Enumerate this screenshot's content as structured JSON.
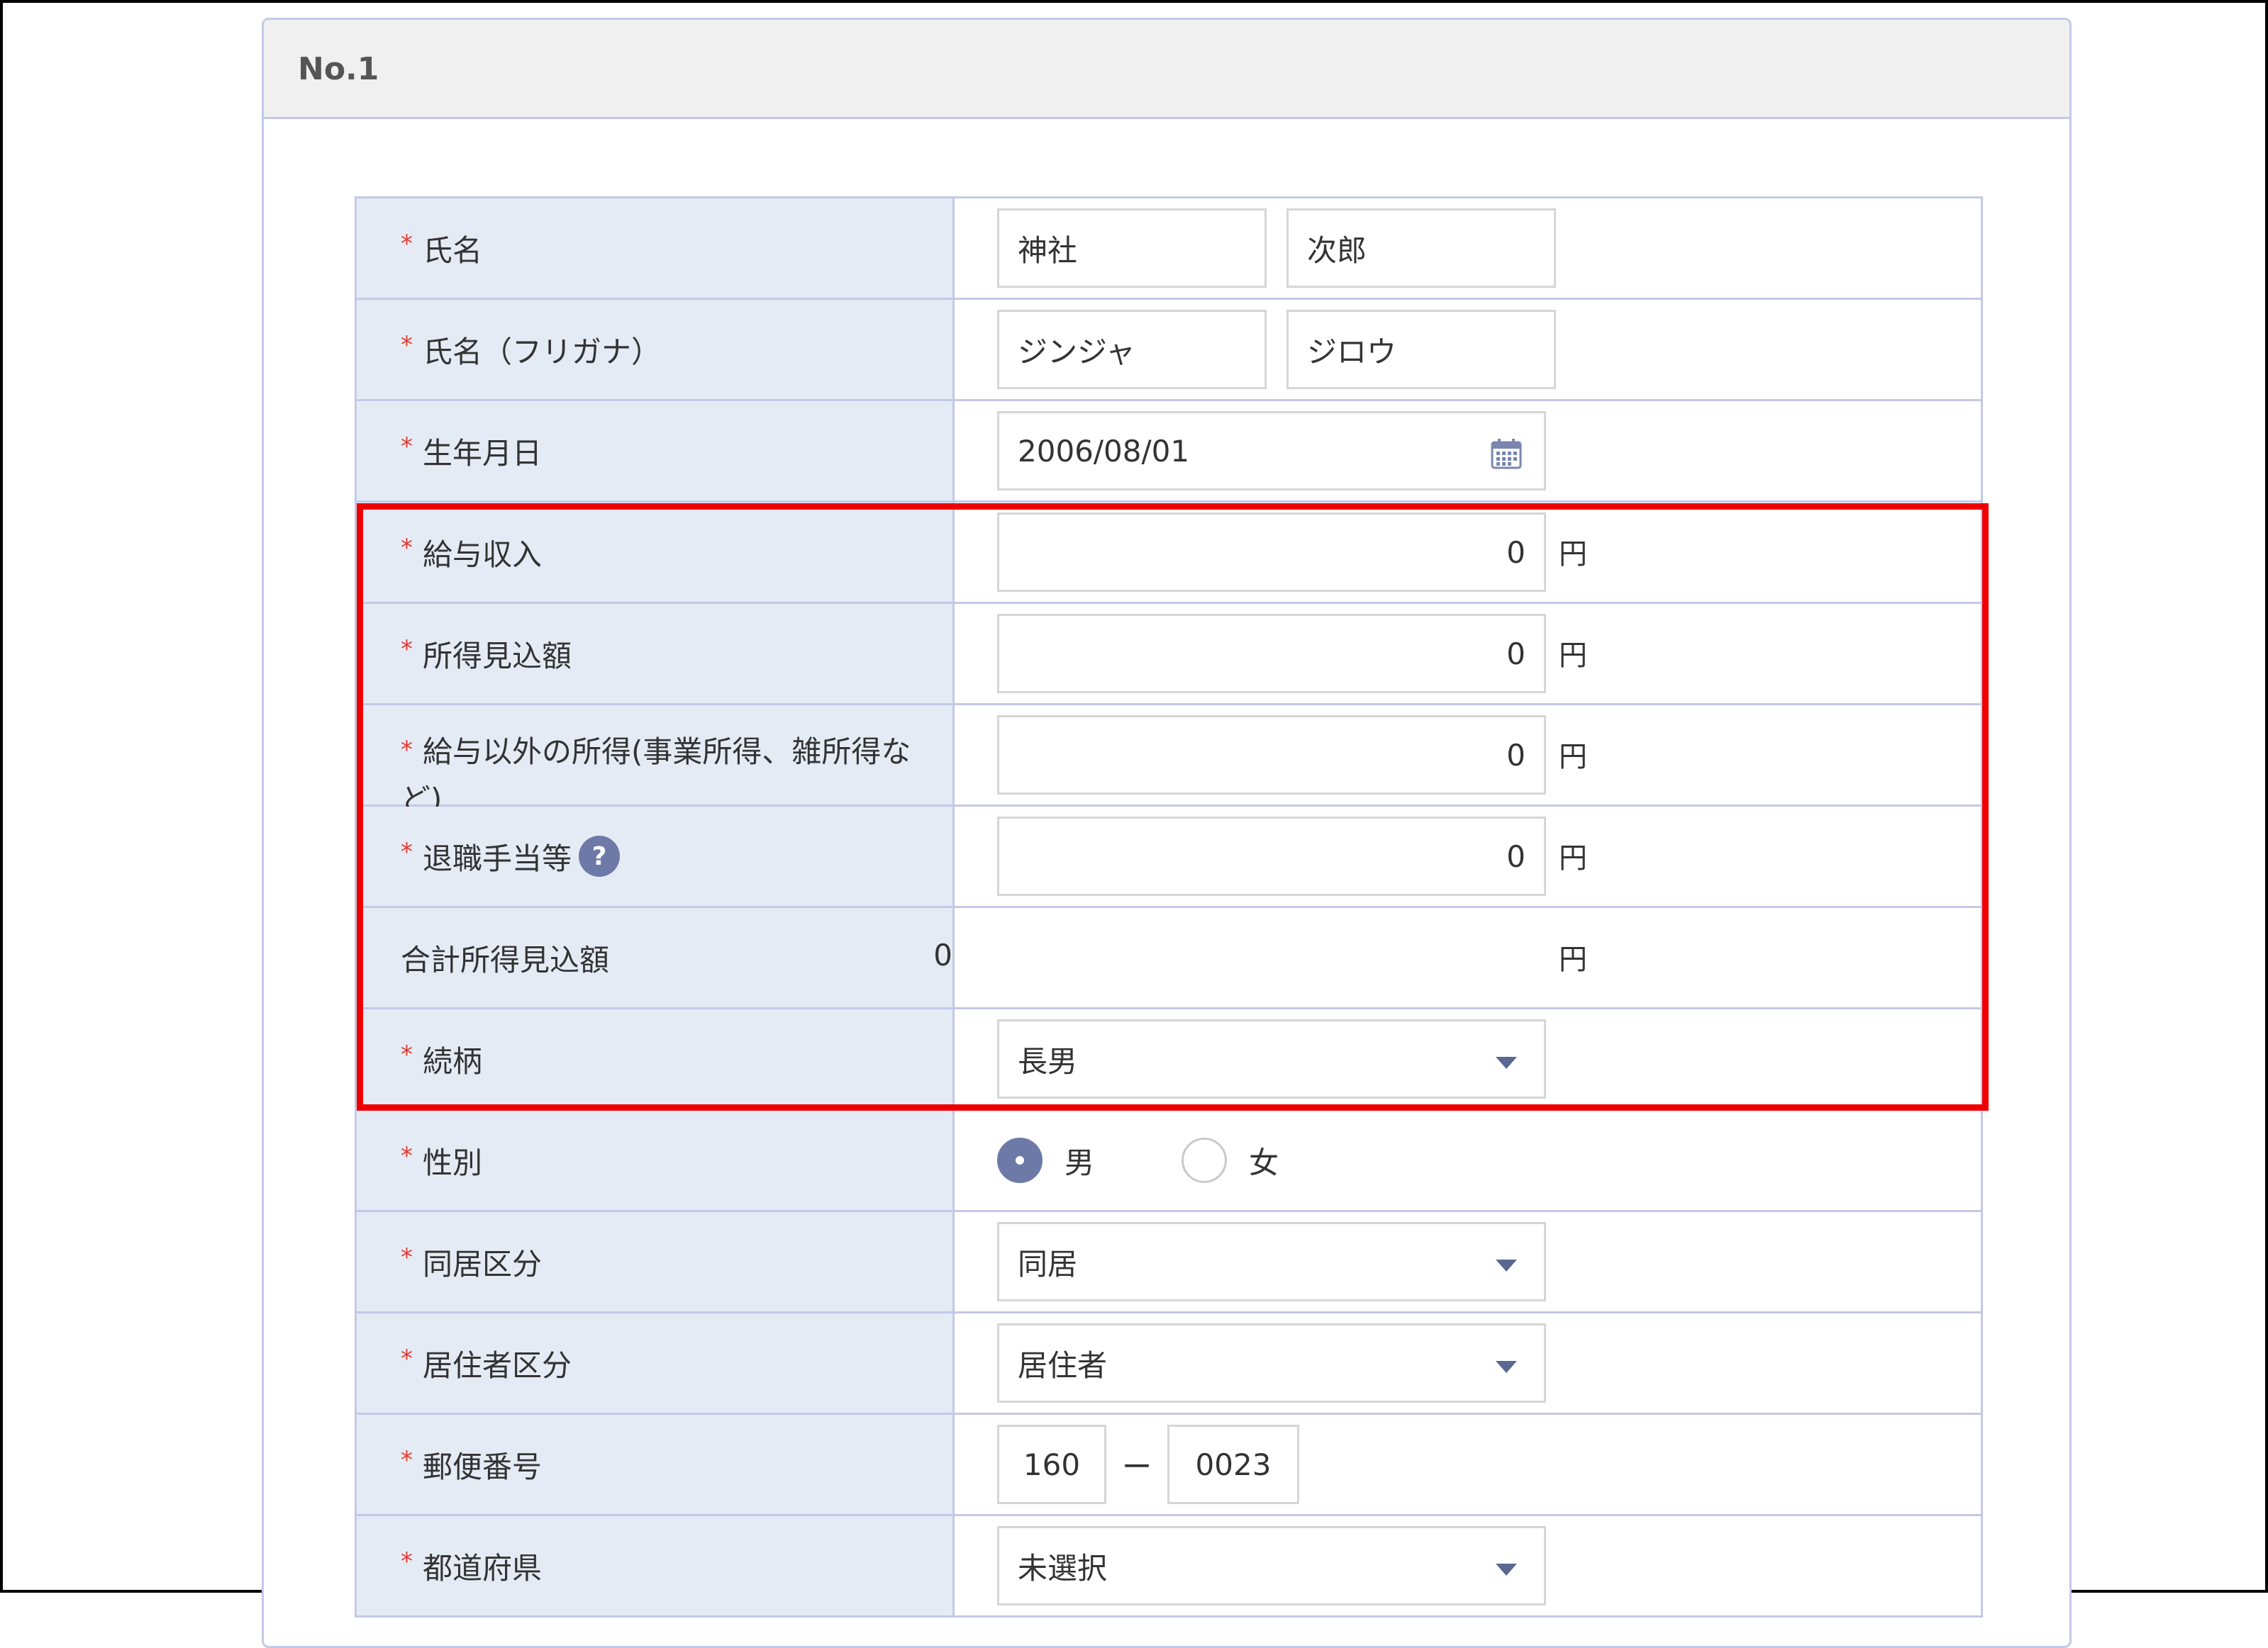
{
  "card": {
    "title": "No.1"
  },
  "required_mark": "*",
  "fields": {
    "name": {
      "label": "氏名",
      "last": "神社",
      "first": "次郎"
    },
    "kana": {
      "label": "氏名（フリガナ）",
      "last": "ジンジャ",
      "first": "ジロウ"
    },
    "birthdate": {
      "label": "生年月日",
      "value": "2006/08/01",
      "icon": "calendar-icon"
    },
    "salary": {
      "label": "給与収入",
      "value": "0",
      "unit": "円"
    },
    "income_estimate": {
      "label": "所得見込額",
      "value": "0",
      "unit": "円"
    },
    "other_income": {
      "label": "給与以外の所得(事業所得、雑所得など)",
      "value": "0",
      "unit": "円"
    },
    "retirement": {
      "label": "退職手当等",
      "help": "?",
      "value": "0",
      "unit": "円"
    },
    "total_income": {
      "label": "合計所得見込額",
      "value": "0",
      "unit": "円"
    },
    "relationship": {
      "label": "続柄",
      "selected": "長男"
    },
    "gender": {
      "label": "性別",
      "options": [
        "男",
        "女"
      ],
      "selected": "男"
    },
    "cohabitation": {
      "label": "同居区分",
      "selected": "同居"
    },
    "residency": {
      "label": "居住者区分",
      "selected": "居住者"
    },
    "postal": {
      "label": "郵便番号",
      "part1": "160",
      "separator": "ー",
      "part2": "0023"
    },
    "prefecture": {
      "label": "都道府県",
      "selected": "未選択"
    }
  },
  "colors": {
    "highlight": "#ee0000",
    "label_bg": "#e5ebf5",
    "accent": "#6d7aa8",
    "required": "#e8382f"
  }
}
